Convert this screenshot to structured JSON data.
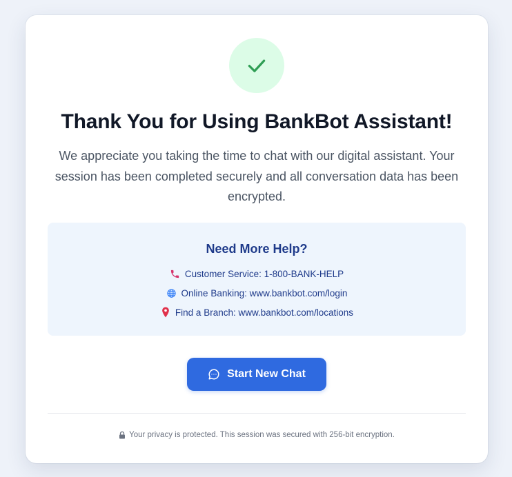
{
  "confirmation": {
    "icon": "checkmark-icon",
    "title": "Thank You for Using BankBot Assistant!",
    "message": "We appreciate you taking the time to chat with our digital assistant. Your session has been completed securely and all conversation data has been encrypted."
  },
  "help": {
    "title": "Need More Help?",
    "items": [
      {
        "icon": "phone-icon",
        "text": "Customer Service: 1-800-BANK-HELP"
      },
      {
        "icon": "globe-icon",
        "text": "Online Banking: www.bankbot.com/login"
      },
      {
        "icon": "map-pin-icon",
        "text": "Find a Branch: www.bankbot.com/locations"
      }
    ]
  },
  "actions": {
    "start_new_chat_label": "Start New Chat",
    "start_new_chat_icon": "chat-bubble-icon"
  },
  "footer": {
    "icon": "lock-icon",
    "privacy_text": "Your privacy is protected. This session was secured with 256-bit encryption."
  },
  "colors": {
    "success": "#16a34a",
    "success_bg": "#dcfce7",
    "primary": "#2f6ae0",
    "help_bg": "#eef5fd",
    "help_text": "#1e3a8a"
  }
}
